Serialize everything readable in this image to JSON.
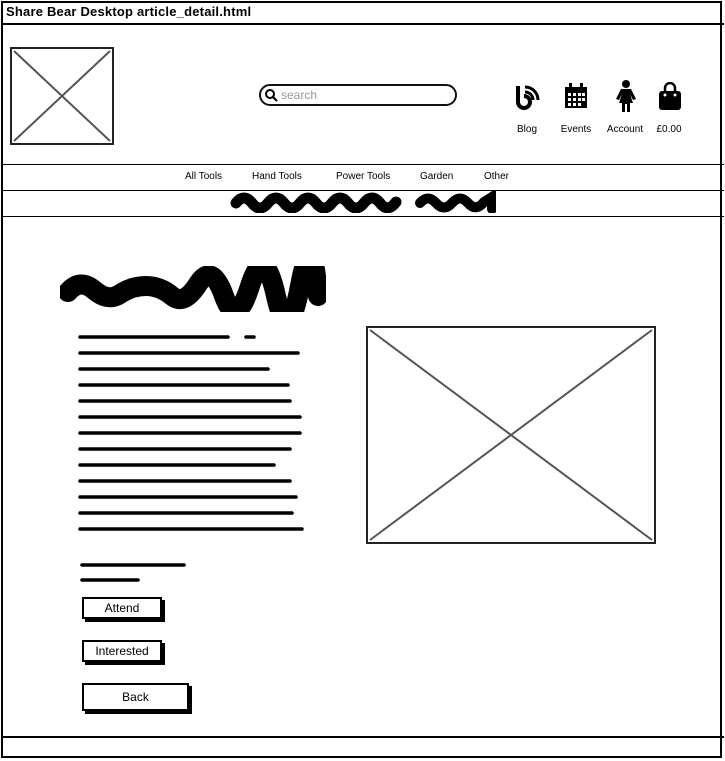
{
  "window": {
    "title": "Share Bear Desktop article_detail.html"
  },
  "header": {
    "search": {
      "placeholder": "search"
    },
    "icons": [
      {
        "name": "blog-icon",
        "label": "Blog"
      },
      {
        "name": "events-icon",
        "label": "Events"
      },
      {
        "name": "account-icon",
        "label": "Account"
      },
      {
        "name": "bag-icon",
        "label": "£0.00"
      }
    ]
  },
  "nav": {
    "items": [
      "All Tools",
      "Hand Tools",
      "Power Tools",
      "Garden",
      "Other"
    ]
  },
  "article": {
    "buttons": {
      "attend": "Attend",
      "interested": "Interested",
      "back": "Back"
    }
  }
}
